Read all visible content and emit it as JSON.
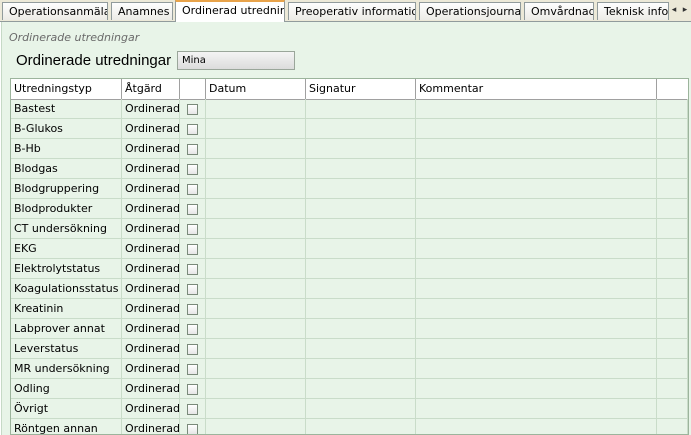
{
  "tabs": [
    {
      "label": "Operationsanmälan",
      "active": false
    },
    {
      "label": "Anamnes",
      "active": false
    },
    {
      "label": "Ordinerad utredning",
      "active": true
    },
    {
      "label": "Preoperativ information",
      "active": false
    },
    {
      "label": "Operationsjournal",
      "active": false
    },
    {
      "label": "Omvårdnad",
      "active": false
    },
    {
      "label": "Teknisk info",
      "active": false
    }
  ],
  "tab_scroll": {
    "left": "◂",
    "right": "▸"
  },
  "section_label": "Ordinerade utredningar",
  "header": {
    "title": "Ordinerade utredningar",
    "filter_value": "Mina"
  },
  "table": {
    "columns": [
      "Utredningstyp",
      "Åtgärd",
      "",
      "Datum",
      "Signatur",
      "Kommentar",
      ""
    ],
    "rows": [
      {
        "type": "Bastest",
        "action": "Ordinerad",
        "checked": false
      },
      {
        "type": "B-Glukos",
        "action": "Ordinerad",
        "checked": false
      },
      {
        "type": "B-Hb",
        "action": "Ordinerad",
        "checked": false
      },
      {
        "type": "Blodgas",
        "action": "Ordinerad",
        "checked": false
      },
      {
        "type": "Blodgruppering",
        "action": "Ordinerad",
        "checked": false
      },
      {
        "type": "Blodprodukter",
        "action": "Ordinerad",
        "checked": false
      },
      {
        "type": "CT undersökning",
        "action": "Ordinerad",
        "checked": false
      },
      {
        "type": "EKG",
        "action": "Ordinerad",
        "checked": false
      },
      {
        "type": "Elektrolytstatus",
        "action": "Ordinerad",
        "checked": false
      },
      {
        "type": "Koagulationsstatus",
        "action": "Ordinerad",
        "checked": false
      },
      {
        "type": "Kreatinin",
        "action": "Ordinerad",
        "checked": false
      },
      {
        "type": "Labprover annat",
        "action": "Ordinerad",
        "checked": false
      },
      {
        "type": "Leverstatus",
        "action": "Ordinerad",
        "checked": false
      },
      {
        "type": "MR undersökning",
        "action": "Ordinerad",
        "checked": false
      },
      {
        "type": "Odling",
        "action": "Ordinerad",
        "checked": false
      },
      {
        "type": "Övrigt",
        "action": "Ordinerad",
        "checked": false
      },
      {
        "type": "Röntgen annan",
        "action": "Ordinerad",
        "checked": false
      }
    ]
  }
}
